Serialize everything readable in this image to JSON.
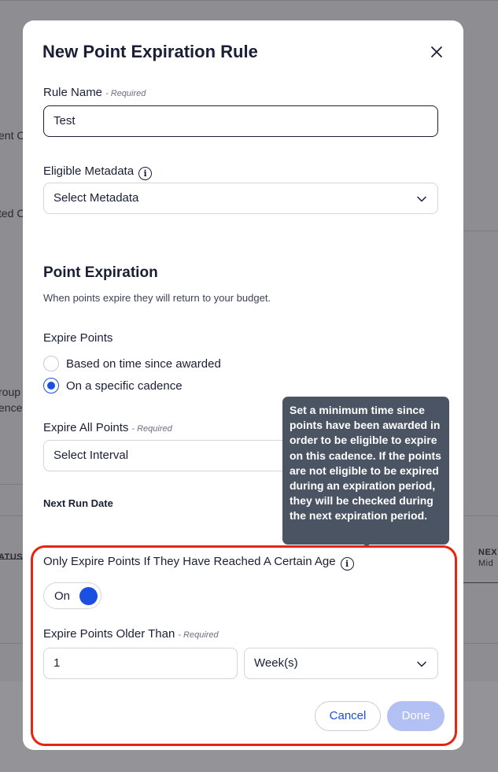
{
  "background": {
    "fragment_1": "ent C",
    "fragment_2": "ted C",
    "fragment_3": "roup",
    "fragment_4": "ence",
    "fragment_5": "ATUS",
    "fragment_6": "NEX",
    "fragment_7": "Mid"
  },
  "modal": {
    "title": "New Point Expiration Rule",
    "close_icon": "close-icon"
  },
  "rule_name": {
    "label": "Rule Name",
    "required": "- Required",
    "value": "Test"
  },
  "metadata": {
    "label": "Eligible Metadata",
    "info_icon": "info-icon",
    "info_glyph": "i",
    "value": "Select Metadata"
  },
  "point_expiration": {
    "title": "Point Expiration",
    "subtitle": "When points expire they will return to your budget."
  },
  "expire_points": {
    "label": "Expire Points",
    "options": [
      {
        "label": "Based on time since awarded",
        "checked": false
      },
      {
        "label": "On a specific cadence",
        "checked": true
      }
    ]
  },
  "expire_all": {
    "label": "Expire All Points",
    "required": "- Required",
    "value": "Select Interval"
  },
  "next_run": {
    "label": "Next Run Date"
  },
  "tooltip": {
    "text": "Set a minimum time since points have been awarded in order to be eligible to expire on this cadence. If the points are not eligible to be expired during an expiration period, they will be checked during the next expiration period."
  },
  "age_rule": {
    "label": "Only Expire Points If They Have Reached A Certain Age",
    "info_glyph": "i",
    "toggle_label": "On",
    "toggle_on": true
  },
  "older_than": {
    "label": "Expire Points Older Than",
    "required": "- Required",
    "amount": "1",
    "unit": "Week(s)"
  },
  "buttons": {
    "cancel": "Cancel",
    "done": "Done"
  },
  "colors": {
    "accent": "#1b4fe0",
    "highlight": "#e8230f",
    "tooltip_bg": "#4a5463"
  }
}
